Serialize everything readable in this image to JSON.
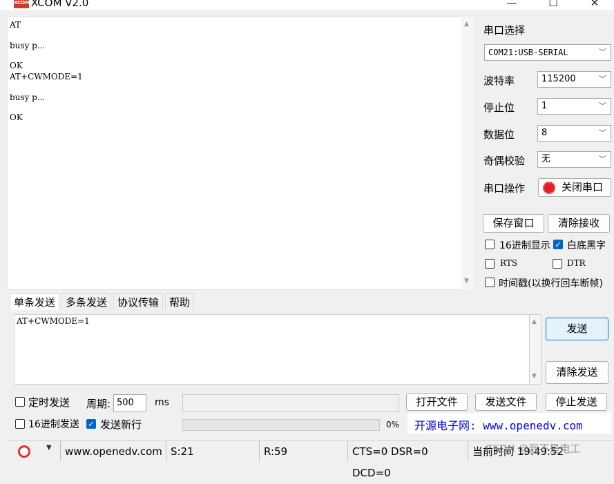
{
  "window": {
    "title": "XCOM V2.0",
    "icon_text": "XCOM",
    "minimize": "—",
    "maximize": "☐",
    "close": "✕"
  },
  "receive": {
    "lines": [
      "AT",
      "busy p...",
      "OK",
      "AT+CWMODE=1",
      "busy p...",
      "OK"
    ]
  },
  "panel": {
    "port_select_label": "串口选择",
    "port_value": "COM21:USB-SERIAL",
    "baud_label": "波特率",
    "baud_value": "115200",
    "stop_label": "停止位",
    "stop_value": "1",
    "data_label": "数据位",
    "data_value": "8",
    "parity_label": "奇偶校验",
    "parity_value": "无",
    "op_label": "串口操作",
    "close_port_btn": "关闭串口",
    "save_window_btn": "保存窗口",
    "clear_recv_btn": "清除接收",
    "hex_display": "16进制显示",
    "white_bg": "白底黑字",
    "rts": "RTS",
    "dtr": "DTR",
    "timestamp": "时间戳(以换行回车断帧)"
  },
  "tabs": [
    "单条发送",
    "多条发送",
    "协议传输",
    "帮助"
  ],
  "send": {
    "text": "AT+CWMODE=1",
    "send_btn": "发送",
    "clear_send_btn": "清除发送",
    "timed_send": "定时发送",
    "period_label": "周期:",
    "period_value": "500",
    "period_unit": "ms",
    "open_file_btn": "打开文件",
    "send_file_btn": "发送文件",
    "stop_send_btn": "停止发送",
    "hex_send": "16进制发送",
    "send_newline": "发送新行",
    "progress_text": "0%",
    "progress": 0,
    "site_banner": "开源电子网: www.openedv.com"
  },
  "status": {
    "url": "www.openedv.com",
    "sent": "S:21",
    "recv": "R:59",
    "lines": "CTS=0 DSR=0 DCD=0",
    "time": "当前时间 19:49:52",
    "watermark": "CSDN @我不是电工"
  },
  "colors": {
    "accent": "#0067c0",
    "send_btn_bg": "#e5f1fb",
    "send_btn_border": "#0078d7",
    "banner_text": "#0000ff",
    "stop_icon": "#e02020"
  }
}
